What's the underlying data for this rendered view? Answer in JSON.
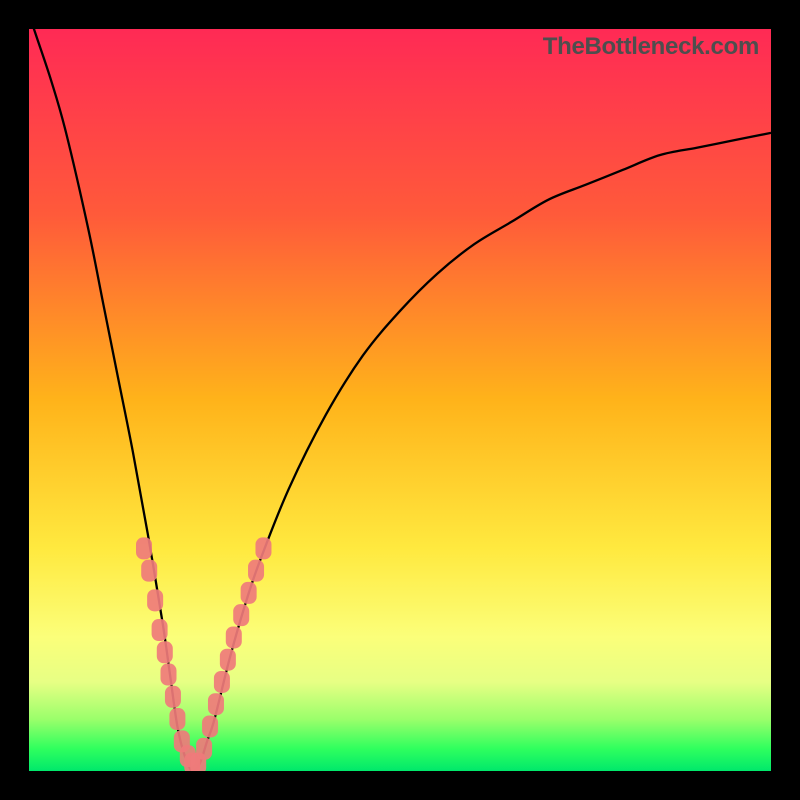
{
  "watermark": "TheBottleneck.com",
  "colors": {
    "frame": "#000000",
    "gradient_top": "#ff2a55",
    "gradient_mid1": "#ffb31a",
    "gradient_mid2": "#ffe93f",
    "gradient_bottom": "#00e86b",
    "curve": "#000000",
    "points": "#ef7b7b"
  },
  "chart_data": {
    "type": "line",
    "title": "",
    "xlabel": "",
    "ylabel": "",
    "xlim": [
      0,
      100
    ],
    "ylim": [
      0,
      100
    ],
    "notch_x": 22,
    "curve": [
      {
        "x": 0,
        "y": 102
      },
      {
        "x": 1,
        "y": 99
      },
      {
        "x": 3,
        "y": 93
      },
      {
        "x": 5,
        "y": 86
      },
      {
        "x": 8,
        "y": 73
      },
      {
        "x": 10,
        "y": 63
      },
      {
        "x": 12,
        "y": 53
      },
      {
        "x": 14,
        "y": 43
      },
      {
        "x": 16,
        "y": 32
      },
      {
        "x": 18,
        "y": 20
      },
      {
        "x": 19,
        "y": 13
      },
      {
        "x": 20,
        "y": 6
      },
      {
        "x": 21,
        "y": 2
      },
      {
        "x": 22,
        "y": 0
      },
      {
        "x": 23,
        "y": 1
      },
      {
        "x": 24,
        "y": 4
      },
      {
        "x": 25,
        "y": 7
      },
      {
        "x": 27,
        "y": 15
      },
      {
        "x": 29,
        "y": 22
      },
      {
        "x": 31,
        "y": 28
      },
      {
        "x": 35,
        "y": 38
      },
      {
        "x": 40,
        "y": 48
      },
      {
        "x": 45,
        "y": 56
      },
      {
        "x": 50,
        "y": 62
      },
      {
        "x": 55,
        "y": 67
      },
      {
        "x": 60,
        "y": 71
      },
      {
        "x": 65,
        "y": 74
      },
      {
        "x": 70,
        "y": 77
      },
      {
        "x": 75,
        "y": 79
      },
      {
        "x": 80,
        "y": 81
      },
      {
        "x": 85,
        "y": 83
      },
      {
        "x": 90,
        "y": 84
      },
      {
        "x": 95,
        "y": 85
      },
      {
        "x": 100,
        "y": 86
      }
    ],
    "points_left": [
      {
        "x": 15.5,
        "y": 30
      },
      {
        "x": 16.2,
        "y": 27
      },
      {
        "x": 17.0,
        "y": 23
      },
      {
        "x": 17.6,
        "y": 19
      },
      {
        "x": 18.3,
        "y": 16
      },
      {
        "x": 18.8,
        "y": 13
      },
      {
        "x": 19.4,
        "y": 10
      },
      {
        "x": 20.0,
        "y": 7
      },
      {
        "x": 20.6,
        "y": 4
      },
      {
        "x": 21.4,
        "y": 2
      },
      {
        "x": 22.0,
        "y": 1
      }
    ],
    "points_right": [
      {
        "x": 22.8,
        "y": 1
      },
      {
        "x": 23.6,
        "y": 3
      },
      {
        "x": 24.4,
        "y": 6
      },
      {
        "x": 25.2,
        "y": 9
      },
      {
        "x": 26.0,
        "y": 12
      },
      {
        "x": 26.8,
        "y": 15
      },
      {
        "x": 27.6,
        "y": 18
      },
      {
        "x": 28.6,
        "y": 21
      },
      {
        "x": 29.6,
        "y": 24
      },
      {
        "x": 30.6,
        "y": 27
      },
      {
        "x": 31.6,
        "y": 30
      }
    ]
  }
}
